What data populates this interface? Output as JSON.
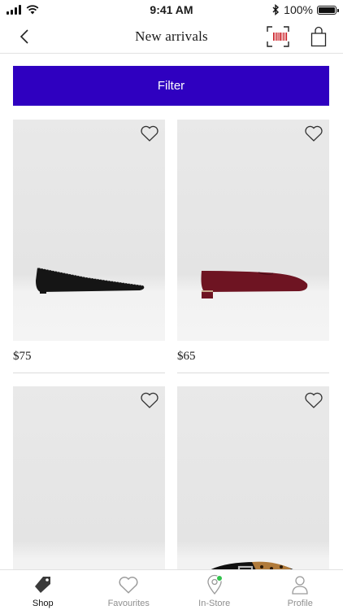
{
  "status_bar": {
    "time": "9:41 AM",
    "battery": "100%",
    "battery_level": 1.0
  },
  "nav": {
    "title": "New arrivals",
    "icons": [
      "back-chevron-icon",
      "barcode-scanner-icon",
      "shopping-bag-icon"
    ]
  },
  "filter": {
    "label": "Filter"
  },
  "products": [
    {
      "price": "$75",
      "color": "#151515",
      "style": "flat",
      "icon": "heart-outline-icon"
    },
    {
      "price": "$65",
      "color": "#6e1422",
      "style": "loafer",
      "icon": "heart-outline-icon"
    },
    {
      "price": "",
      "color": "#121212",
      "style": "loafer",
      "icon": "heart-outline-icon"
    },
    {
      "price": "",
      "color": "#101010",
      "style": "creeper",
      "icon": "heart-outline-icon"
    }
  ],
  "tabs": [
    {
      "label": "Shop",
      "icon": "tag-icon",
      "active": true
    },
    {
      "label": "Favourites",
      "icon": "heart-icon",
      "active": false
    },
    {
      "label": "In-Store",
      "icon": "location-pin-icon",
      "active": false,
      "badge_color": "#33c24d"
    },
    {
      "label": "Profile",
      "icon": "person-icon",
      "active": false
    }
  ],
  "colors": {
    "accent": "#2f00c0",
    "barcode": "#c9141c",
    "badge": "#33c24d"
  }
}
